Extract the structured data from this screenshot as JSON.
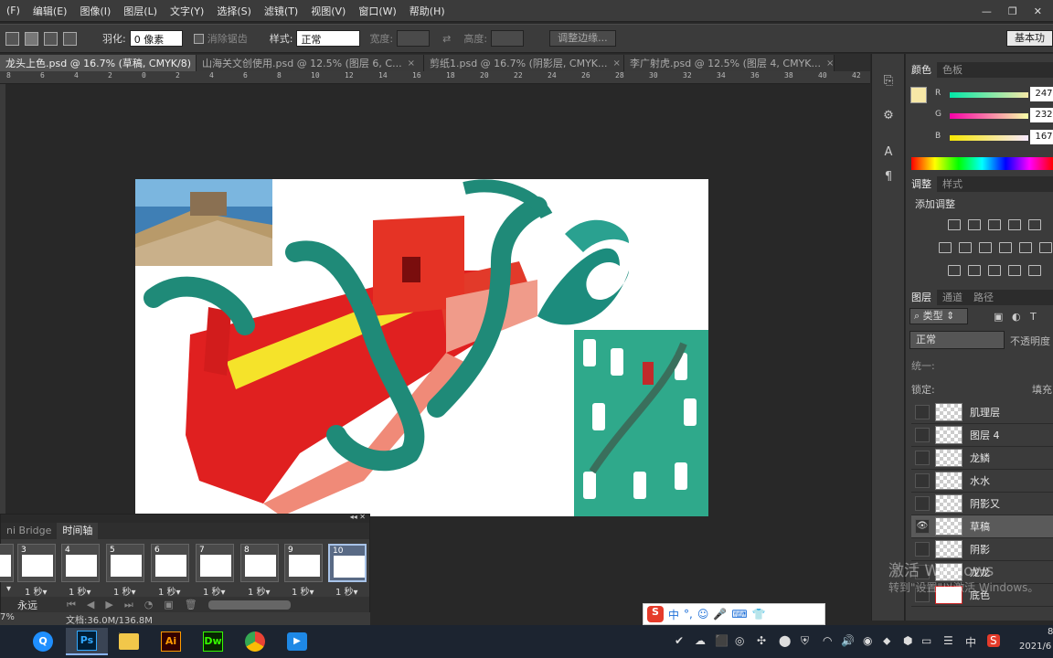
{
  "menu": [
    "(F)",
    "编辑(E)",
    "图像(I)",
    "图层(L)",
    "文字(Y)",
    "选择(S)",
    "滤镜(T)",
    "视图(V)",
    "窗口(W)",
    "帮助(H)"
  ],
  "window_controls": {
    "minimize": "—",
    "restore": "❐",
    "close": "✕"
  },
  "options": {
    "feather_label": "羽化:",
    "feather_value": "0 像素",
    "antialias_label": "消除锯齿",
    "style_label": "样式:",
    "style_value": "正常",
    "width_label": "宽度:",
    "height_label": "高度:",
    "refine_button": "调整边缘...",
    "workspace": "基本功"
  },
  "tabs": [
    {
      "title": "龙头上色.psd @ 16.7% (草稿, CMYK/8)",
      "close": "×",
      "active": true
    },
    {
      "title": "山海关文创使用.psd @ 12.5% (图层 6, C...",
      "close": "×",
      "active": false
    },
    {
      "title": "剪纸1.psd @ 16.7% (阴影层, CMYK...",
      "close": "×",
      "active": false
    },
    {
      "title": "李广射虎.psd @ 12.5% (图层 4, CMYK...",
      "close": "×",
      "active": false
    }
  ],
  "ruler_labels": [
    "8",
    "6",
    "4",
    "2",
    "0",
    "2",
    "4",
    "6",
    "8",
    "10",
    "12",
    "14",
    "16",
    "18",
    "20",
    "22",
    "24",
    "26",
    "28",
    "30",
    "32",
    "34",
    "36",
    "38",
    "40",
    "42"
  ],
  "color_panel": {
    "tabs": [
      "颜色",
      "色板"
    ],
    "foreground": "#f7e8a7",
    "r_label": "R",
    "r": "247",
    "g_label": "G",
    "g": "232",
    "b_label": "B",
    "b": "167"
  },
  "adjust_panel": {
    "tabs": [
      "调整",
      "样式"
    ],
    "title": "添加调整"
  },
  "layers_panel": {
    "tabs": [
      "图层",
      "通道",
      "路径"
    ],
    "filter_value": "类型",
    "blend_mode": "正常",
    "opacity_label": "不透明度",
    "unify_label": "统一:",
    "lock_label": "锁定:",
    "fill_label": "填充",
    "layers": [
      {
        "name": "肌理层",
        "visible": false,
        "selected": false
      },
      {
        "name": "图层 4",
        "visible": false,
        "selected": false
      },
      {
        "name": "龙鳞",
        "visible": false,
        "selected": false
      },
      {
        "name": "水水",
        "visible": false,
        "selected": false
      },
      {
        "name": "阴影又",
        "visible": false,
        "selected": false
      },
      {
        "name": "草稿",
        "visible": true,
        "selected": true
      },
      {
        "name": "阴影",
        "visible": false,
        "selected": false
      },
      {
        "name": "龙龙",
        "visible": false,
        "selected": false
      },
      {
        "name": "底色",
        "visible": false,
        "selected": false
      }
    ]
  },
  "timeline": {
    "tabs": [
      "ni Bridge",
      "时间轴"
    ],
    "frames": [
      {
        "num": "",
        "dur": "▾"
      },
      {
        "num": "3",
        "dur": "1 秒▾"
      },
      {
        "num": "4",
        "dur": "1 秒▾"
      },
      {
        "num": "5",
        "dur": "1 秒▾"
      },
      {
        "num": "6",
        "dur": "1 秒▾"
      },
      {
        "num": "7",
        "dur": "1 秒▾"
      },
      {
        "num": "8",
        "dur": "1 秒▾"
      },
      {
        "num": "9",
        "dur": "1 秒▾"
      },
      {
        "num": "10",
        "dur": "1 秒▾"
      }
    ],
    "loop": "永远",
    "panel_controls": "◂◂ ✕"
  },
  "status": {
    "zoom": "7%",
    "doc": "文档:36.0M/136.8M"
  },
  "ime": [
    "中",
    "°,",
    "☺",
    "🎤",
    "⌨",
    "👕"
  ],
  "watermark": {
    "line1": "激活 Windows",
    "line2": "转到\"设置\"以激活 Windows。"
  },
  "tray": {
    "ime": "中",
    "time": "8",
    "date": "2021/6"
  },
  "taskbar_apps": [
    {
      "name": "browser-q",
      "label": "Q",
      "color": "#1f8fff"
    },
    {
      "name": "photoshop",
      "label": "Ps",
      "color": "#31a8ff"
    },
    {
      "name": "explorer",
      "label": "▬",
      "color": "#f2c74a"
    },
    {
      "name": "illustrator",
      "label": "Ai",
      "color": "#ff9a00"
    },
    {
      "name": "dreamweaver",
      "label": "Dw",
      "color": "#35fa00"
    },
    {
      "name": "chrome",
      "label": "●",
      "color": "#ea4335"
    },
    {
      "name": "video-app",
      "label": "▶",
      "color": "#1e88e5"
    }
  ]
}
